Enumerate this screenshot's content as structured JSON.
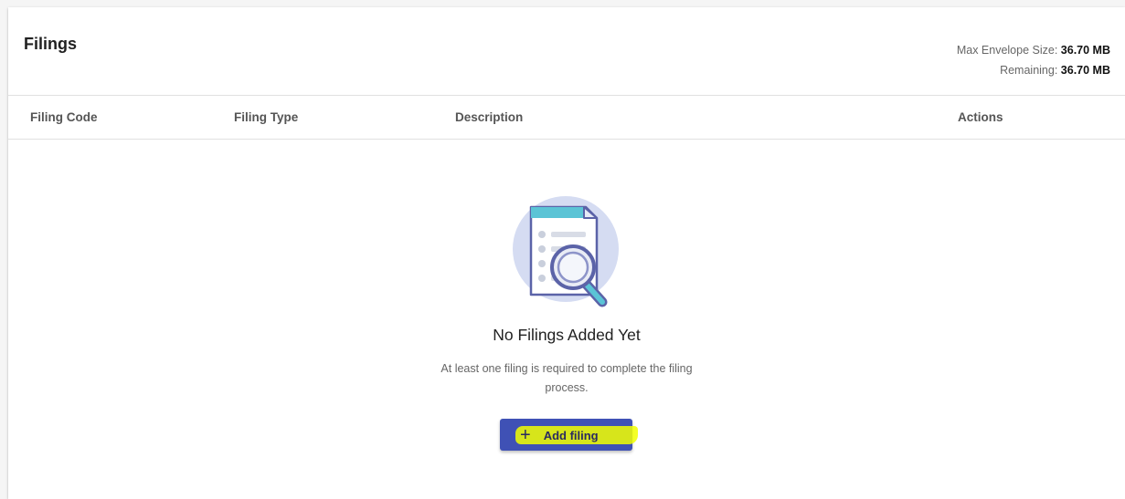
{
  "header": {
    "title": "Filings",
    "max_envelope_label": "Max Envelope Size:",
    "max_envelope_value": "36.70 MB",
    "remaining_label": "Remaining:",
    "remaining_value": "36.70 MB"
  },
  "table": {
    "columns": [
      "Filing Code",
      "Filing Type",
      "Description",
      "Actions"
    ],
    "rows": []
  },
  "empty_state": {
    "illustration_icon": "document-search-icon",
    "title": "No Filings Added Yet",
    "message": "At least one filing is required to complete the filing process."
  },
  "actions": {
    "add_filing_label": "Add filing",
    "add_filing_icon": "plus-icon"
  },
  "colors": {
    "primary": "#3f51b5",
    "highlight": "#f2ff00",
    "illustration_circle": "#d5dcf2",
    "illustration_accent": "#5bc4d6",
    "illustration_outline": "#5b63a8"
  }
}
